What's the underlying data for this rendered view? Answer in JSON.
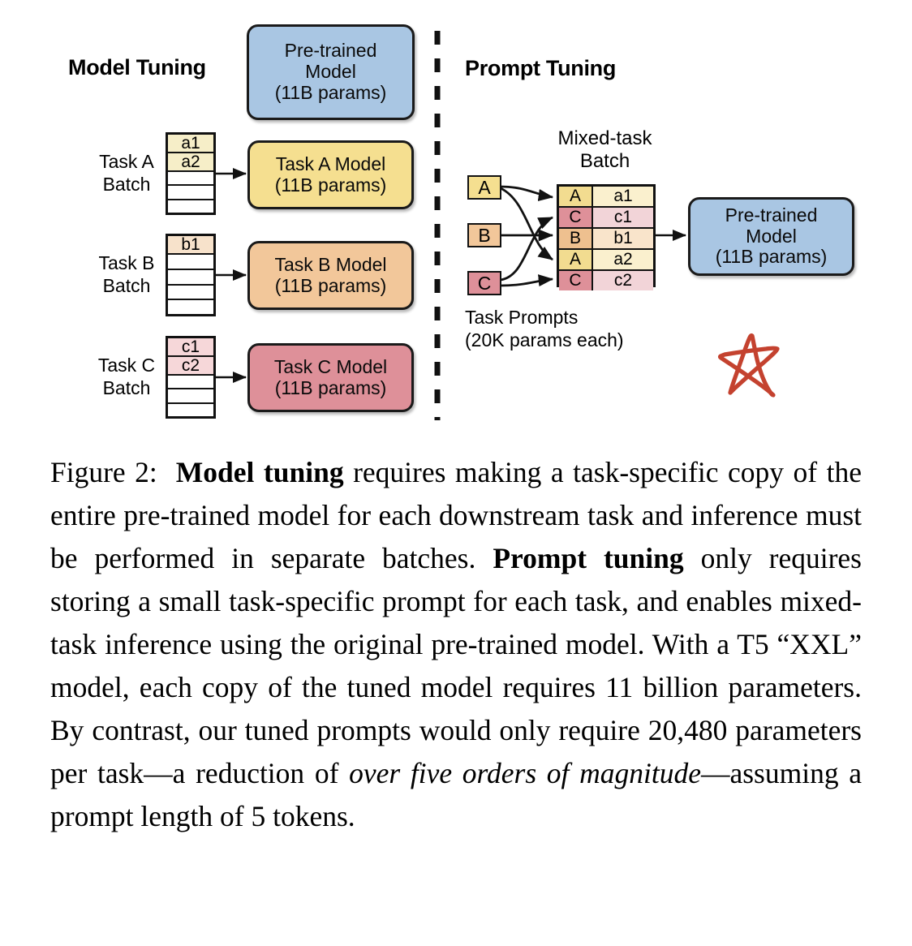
{
  "figure": {
    "left_panel": {
      "title": "Model Tuning",
      "pretrained_box": {
        "line1": "Pre-trained",
        "line2": "Model",
        "line3": "(11B params)",
        "color": "#A9C6E3"
      },
      "rows": [
        {
          "batch_label_line1": "Task A",
          "batch_label_line2": "Batch",
          "cells": [
            "a1",
            "a2",
            "",
            "",
            ""
          ],
          "cell_color": "#F6EEC8",
          "model_line1": "Task A Model",
          "model_line2": "(11B params)",
          "model_color": "#F5DF90"
        },
        {
          "batch_label_line1": "Task B",
          "batch_label_line2": "Batch",
          "cells": [
            "b1",
            "",
            "",
            "",
            ""
          ],
          "cell_color": "#F7E2CB",
          "model_line1": "Task B Model",
          "model_line2": "(11B params)",
          "model_color": "#F2C79A"
        },
        {
          "batch_label_line1": "Task C",
          "batch_label_line2": "Batch",
          "cells": [
            "c1",
            "c2",
            "",
            "",
            ""
          ],
          "cell_color": "#F6D7D9",
          "model_line1": "Task C Model",
          "model_line2": "(11B params)",
          "model_color": "#DE9099"
        }
      ]
    },
    "right_panel": {
      "title": "Prompt Tuning",
      "mixed_batch_label_line1": "Mixed-task",
      "mixed_batch_label_line2": "Batch",
      "prompts_label_line1": "Task Prompts",
      "prompts_label_line2": "(20K params each)",
      "prompt_chips": [
        {
          "label": "A",
          "color": "#F5DF90"
        },
        {
          "label": "B",
          "color": "#F2C79A"
        },
        {
          "label": "C",
          "color": "#DE9099"
        }
      ],
      "mixed_batch_rows": [
        {
          "tag": "A",
          "value": "a1",
          "tag_color": "#F2DC90",
          "value_color": "#FAF0CE"
        },
        {
          "tag": "C",
          "value": "c1",
          "tag_color": "#DE9099",
          "value_color": "#F2D4D8"
        },
        {
          "tag": "B",
          "value": "b1",
          "tag_color": "#EEC08F",
          "value_color": "#F9E4CB"
        },
        {
          "tag": "A",
          "value": "a2",
          "tag_color": "#F2DC90",
          "value_color": "#FAF0CE"
        },
        {
          "tag": "C",
          "value": "c2",
          "tag_color": "#DE9099",
          "value_color": "#F2D4D8"
        }
      ],
      "pretrained_box": {
        "line1": "Pre-trained",
        "line2": "Model",
        "line3": "(11B params)",
        "color": "#A9C6E3"
      }
    },
    "annotation": {
      "name": "hand-drawn-star",
      "color": "#C4422F"
    },
    "divider": {
      "style": "dashed-vertical",
      "color": "#111111"
    }
  },
  "caption": {
    "label": "Figure 2:",
    "bold_1": "Model tuning",
    "text_1": " requires making a task-specific copy of the entire pre-trained model for each downstream task and inference must be performed in separate batches. ",
    "bold_2": "Prompt tuning",
    "text_2": " only requires storing a small task-specific prompt for each task, and enables mixed-task inference using the original pre-trained model. With a T5 “XXL” model, each copy of the tuned model requires 11 billion parameters. By contrast, our tuned prompts would only require 20,480 parameters per task—a reduction of ",
    "italic_1": "over five orders of magnitude",
    "text_3": "—assuming a prompt length of 5 tokens."
  }
}
